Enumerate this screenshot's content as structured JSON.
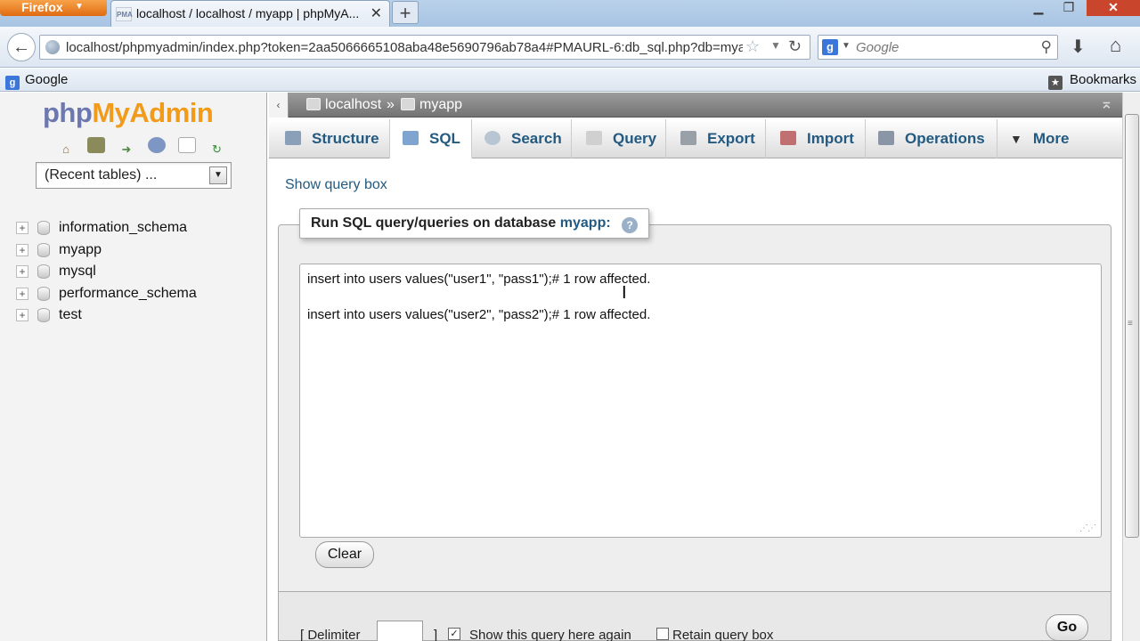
{
  "browser": {
    "menu_button": "Firefox",
    "tab_title": "localhost / localhost / myapp | phpMyA...",
    "tab_favicon": "PMA",
    "new_tab": "+",
    "url": "localhost/phpmyadmin/index.php?token=2aa5066665108aba48e5690796ab78a4#PMAURL-6:db_sql.php?db=mya",
    "search_placeholder": "Google",
    "bookmark_google": "Google",
    "bookmarks_label": "Bookmarks"
  },
  "sidebar": {
    "logo_php": "php",
    "logo_myadmin": "MyAdmin",
    "recent_tables": "(Recent tables) ...",
    "databases": [
      {
        "name": "information_schema"
      },
      {
        "name": "myapp"
      },
      {
        "name": "mysql"
      },
      {
        "name": "performance_schema"
      },
      {
        "name": "test"
      }
    ]
  },
  "breadcrumb": {
    "server": "localhost",
    "separator": "»",
    "database": "myapp"
  },
  "tabs": [
    {
      "label": "Structure",
      "icon": "structure-icon"
    },
    {
      "label": "SQL",
      "icon": "sql-icon"
    },
    {
      "label": "Search",
      "icon": "search-icon"
    },
    {
      "label": "Query",
      "icon": "query-icon"
    },
    {
      "label": "Export",
      "icon": "export-icon"
    },
    {
      "label": "Import",
      "icon": "import-icon"
    },
    {
      "label": "Operations",
      "icon": "operations-icon"
    },
    {
      "label": "More",
      "icon": "more-icon"
    }
  ],
  "active_tab": "SQL",
  "main": {
    "show_query_box": "Show query box",
    "legend_prefix": "Run SQL query/queries on database",
    "legend_db": "myapp:",
    "sql_lines": [
      "insert into users values(\"user1\", \"pass1\");# 1 row affected.",
      "insert into users values(\"user2\", \"pass2\");# 1 row affected."
    ],
    "clear_button": "Clear",
    "delimiter_label": "[ Delimiter",
    "delimiter_close": "]",
    "show_again_label": "Show this query here again",
    "retain_label": "Retain query box",
    "go_button": "Go"
  },
  "colors": {
    "link": "#235a81",
    "logo_php": "#6c78af",
    "logo_myadmin": "#f29b1b"
  }
}
